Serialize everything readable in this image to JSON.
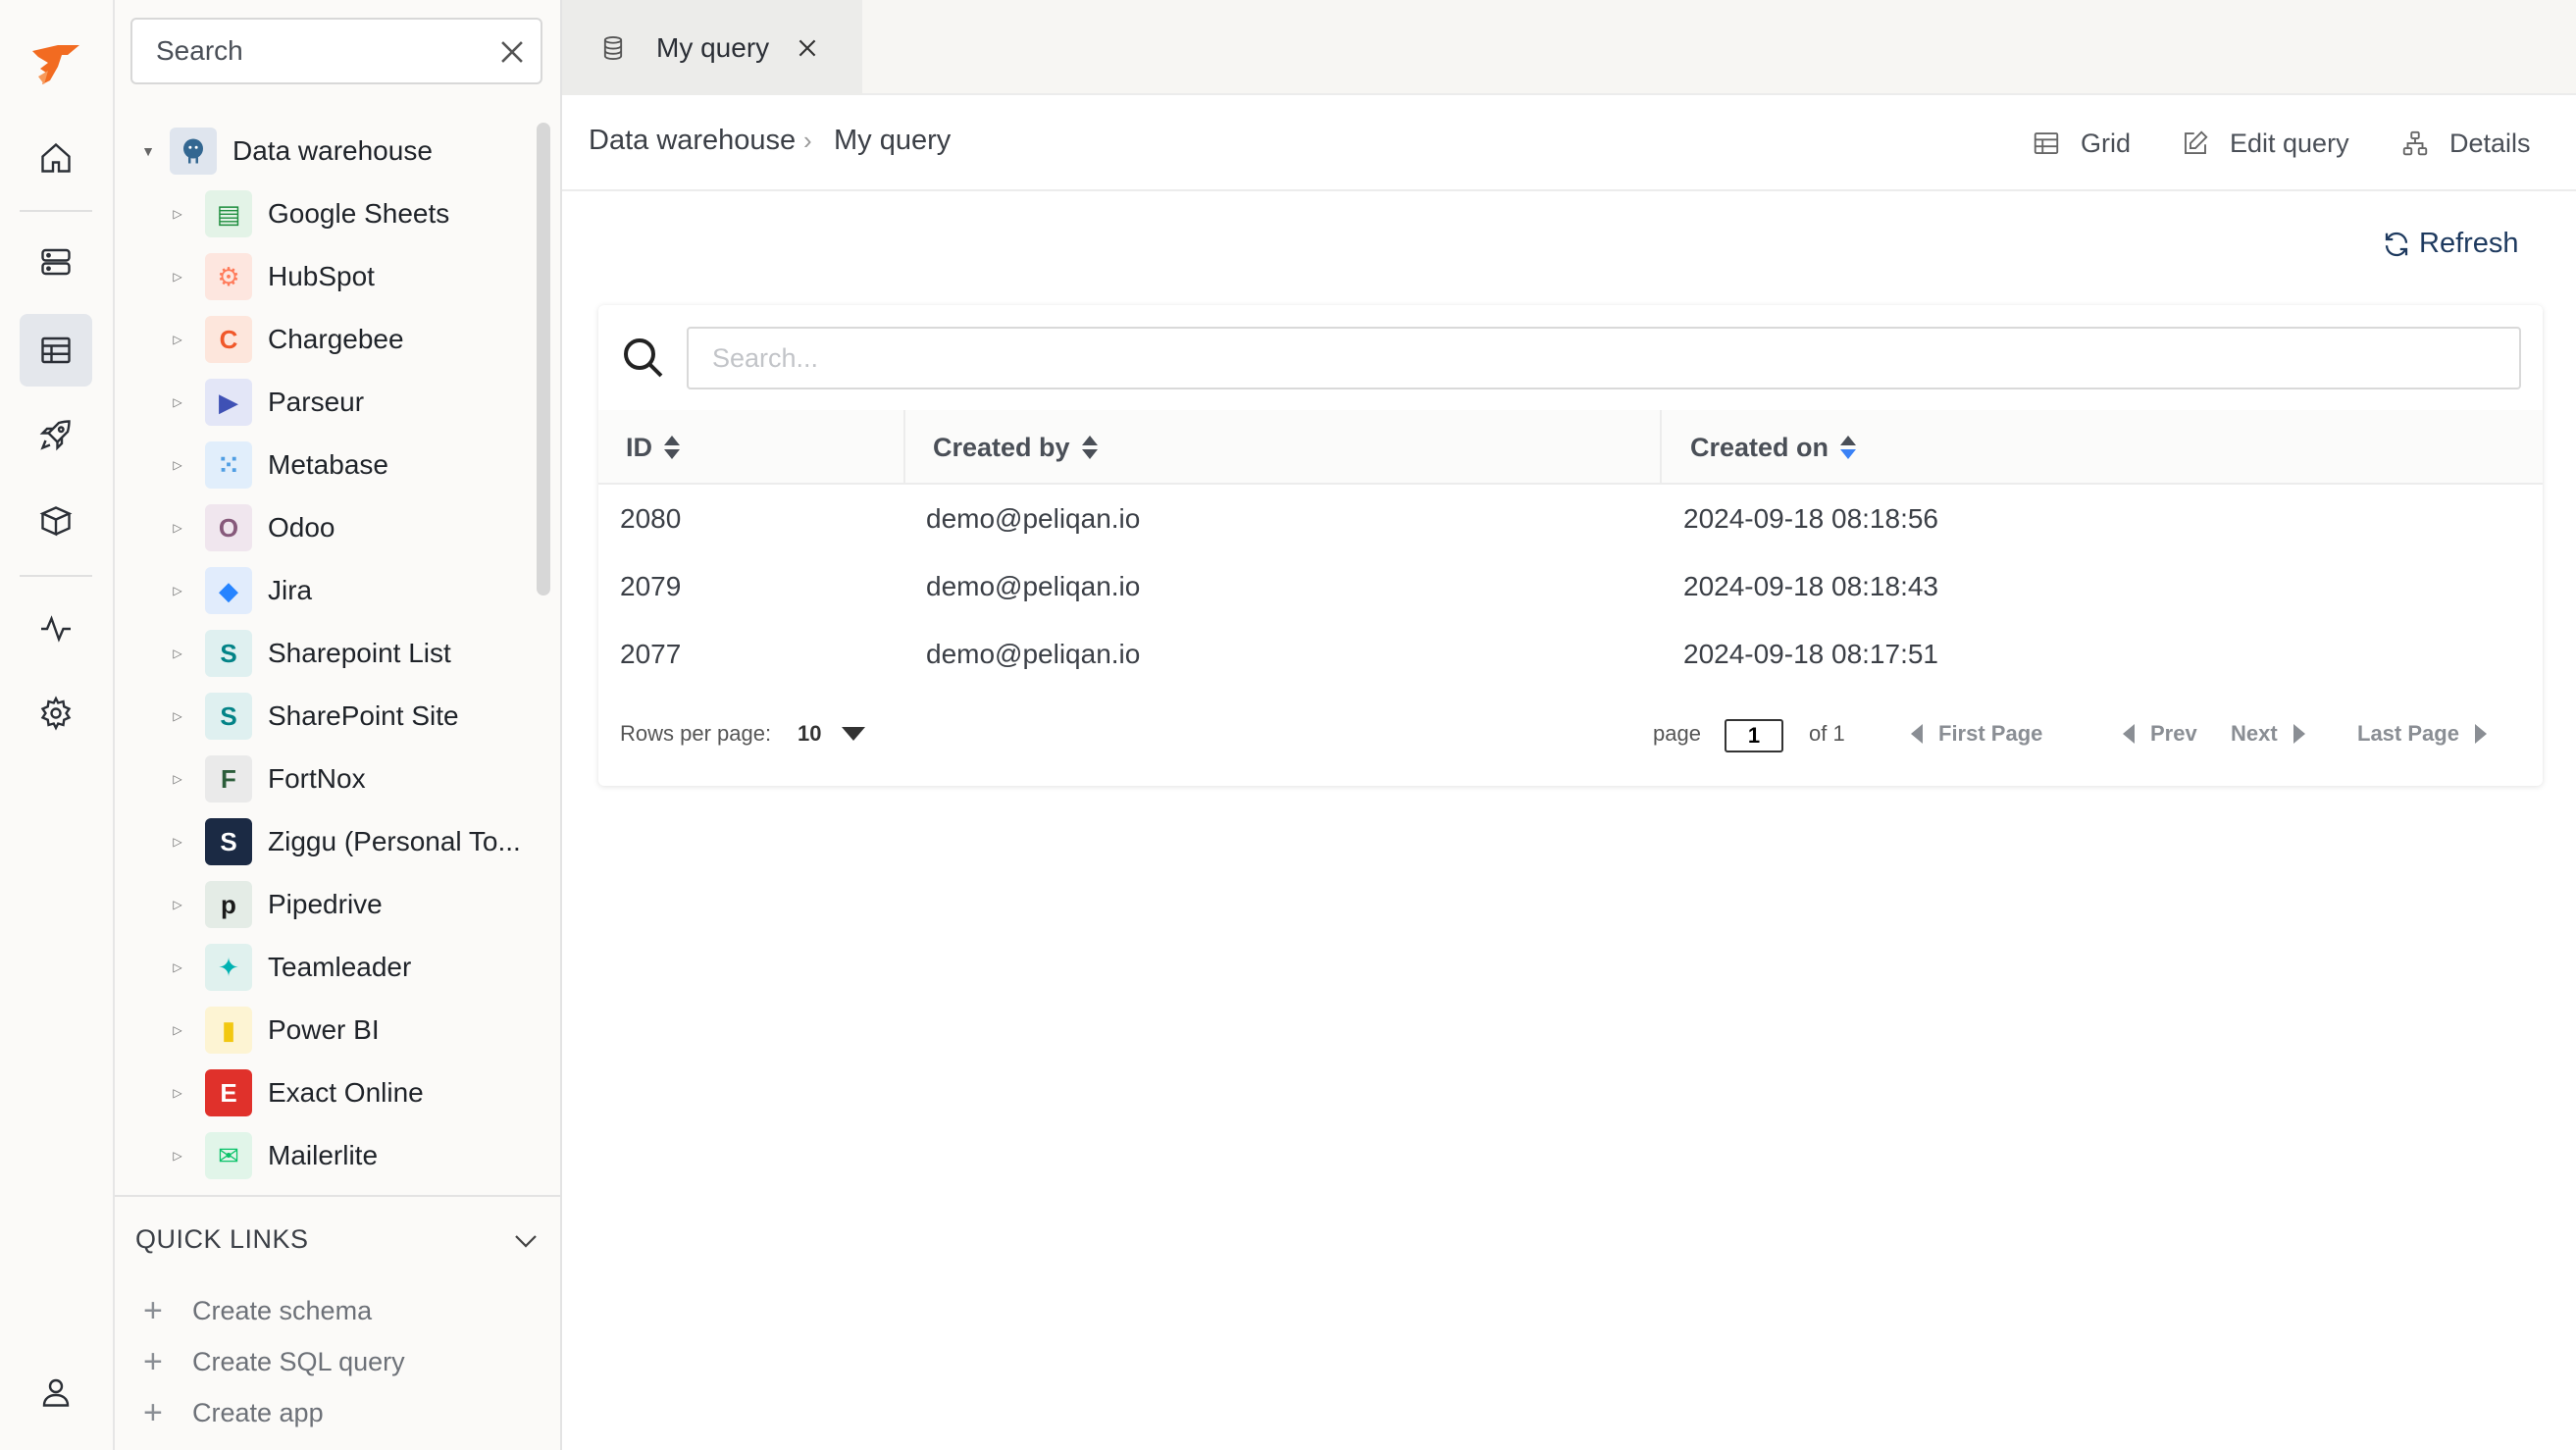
{
  "rail": {
    "items": [
      {
        "name": "logo-icon"
      },
      {
        "name": "home-icon"
      },
      {
        "name": "server-icon"
      },
      {
        "name": "table-icon",
        "active": true
      },
      {
        "name": "rocket-icon"
      },
      {
        "name": "box-icon"
      },
      {
        "name": "activity-icon"
      },
      {
        "name": "gear-icon"
      },
      {
        "name": "user-icon"
      }
    ],
    "brand_color": "#f26b21"
  },
  "sidebar": {
    "search_value": "Search",
    "root": {
      "label": "Data warehouse",
      "expanded": true
    },
    "items": [
      {
        "label": "Google Sheets",
        "icon": "google-sheets-icon",
        "color": "#1e8e3e",
        "bg": "#e3f3e7",
        "glyph": "▤"
      },
      {
        "label": "HubSpot",
        "icon": "hubspot-icon",
        "color": "#ff7a59",
        "bg": "#fde6df",
        "glyph": "⚙"
      },
      {
        "label": "Chargebee",
        "icon": "chargebee-icon",
        "color": "#f0582a",
        "bg": "#fde6dc",
        "glyph": "C"
      },
      {
        "label": "Parseur",
        "icon": "parseur-icon",
        "color": "#3f51b5",
        "bg": "#e3e6f7",
        "glyph": "▶"
      },
      {
        "label": "Metabase",
        "icon": "metabase-icon",
        "color": "#509ee3",
        "bg": "#e1eefb",
        "glyph": "⁙"
      },
      {
        "label": "Odoo",
        "icon": "odoo-icon",
        "color": "#875a7b",
        "bg": "#f0e6ee",
        "glyph": "O"
      },
      {
        "label": "Jira",
        "icon": "jira-icon",
        "color": "#2684ff",
        "bg": "#e1ecfc",
        "glyph": "◆"
      },
      {
        "label": "Sharepoint List",
        "icon": "sharepoint-icon",
        "color": "#038387",
        "bg": "#dff0f0",
        "glyph": "S"
      },
      {
        "label": "SharePoint Site",
        "icon": "sharepoint-icon",
        "color": "#038387",
        "bg": "#dff0f0",
        "glyph": "S"
      },
      {
        "label": "FortNox",
        "icon": "fortnox-icon",
        "color": "#2b5d3a",
        "bg": "#eaeaea",
        "glyph": "F"
      },
      {
        "label": "Ziggu (Personal To...",
        "icon": "ziggu-icon",
        "color": "#ffffff",
        "bg": "#1b2a44",
        "glyph": "S"
      },
      {
        "label": "Pipedrive",
        "icon": "pipedrive-icon",
        "color": "#1a1a1a",
        "bg": "#e4ece6",
        "glyph": "p"
      },
      {
        "label": "Teamleader",
        "icon": "teamleader-icon",
        "color": "#00b2b2",
        "bg": "#e0f1ee",
        "glyph": "✦"
      },
      {
        "label": "Power BI",
        "icon": "powerbi-icon",
        "color": "#f2c811",
        "bg": "#fdf4d3",
        "glyph": "▮"
      },
      {
        "label": "Exact Online",
        "icon": "exact-online-icon",
        "color": "#ffffff",
        "bg": "#e0312b",
        "glyph": "E"
      },
      {
        "label": "Mailerlite",
        "icon": "mailerlite-icon",
        "color": "#09c269",
        "bg": "#e1f5e9",
        "glyph": "✉"
      }
    ],
    "quick_links": {
      "title": "QUICK LINKS",
      "items": [
        "Create schema",
        "Create SQL query",
        "Create app"
      ]
    }
  },
  "tabs": [
    {
      "label": "My query",
      "active": true
    }
  ],
  "breadcrumb": {
    "root": "Data warehouse",
    "separator": "›",
    "current": "My query"
  },
  "header_actions": {
    "grid": "Grid",
    "edit_query": "Edit query",
    "details": "Details"
  },
  "refresh_label": "Refresh",
  "table": {
    "search_placeholder": "Search...",
    "columns": [
      "ID",
      "Created by",
      "Created on"
    ],
    "rows": [
      [
        "2080",
        "demo@peliqan.io",
        "2024-09-18 08:18:56"
      ],
      [
        "2079",
        "demo@peliqan.io",
        "2024-09-18 08:18:43"
      ],
      [
        "2077",
        "demo@peliqan.io",
        "2024-09-18 08:17:51"
      ]
    ],
    "sort_active_color": "#3b82f6"
  },
  "pagination": {
    "rows_per_page_label": "Rows per page:",
    "rows_per_page": "10",
    "page_label": "page",
    "page_value": "1",
    "of_label": "of 1",
    "first": "First Page",
    "prev": "Prev",
    "next": "Next",
    "last": "Last Page"
  }
}
